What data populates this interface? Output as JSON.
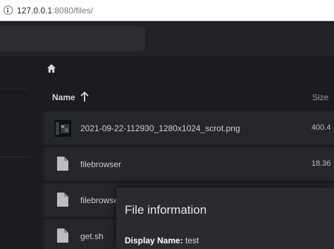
{
  "browser": {
    "url_host": "127.0.0.1",
    "url_rest": ":8080/files/"
  },
  "breadcrumb": {
    "home_icon": "home-icon"
  },
  "list": {
    "col_name": "Name",
    "sort_icon": "arrow-up-icon",
    "col_size": "Size",
    "rows": [
      {
        "name": "2021-09-22-112930_1280x1024_scrot.png",
        "size": "400.4",
        "icon": "image-thumbnail-icon"
      },
      {
        "name": "filebrowser",
        "size": "18.36",
        "icon": "file-icon"
      },
      {
        "name": "filebrowser",
        "size": "",
        "icon": "file-icon"
      },
      {
        "name": "get.sh",
        "size": "",
        "icon": "file-icon"
      }
    ]
  },
  "dialog": {
    "title": "File information",
    "display_name_label": "Display Name:",
    "display_name_value": "test"
  }
}
